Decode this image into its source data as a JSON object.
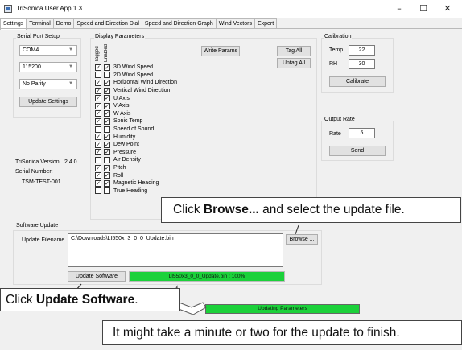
{
  "window": {
    "title": "TriSonica User App 1.3",
    "minimize": "–",
    "maximize": "☐",
    "close": "✕"
  },
  "tabs": [
    {
      "label": "Settings"
    },
    {
      "label": "Terminal"
    },
    {
      "label": "Demo"
    },
    {
      "label": "Speed and Direction Dial"
    },
    {
      "label": "Speed and Direction Graph"
    },
    {
      "label": "Wind Vectors"
    },
    {
      "label": "Expert"
    }
  ],
  "serial_port_setup": {
    "label": "Serial Port Setup",
    "port": "COM4",
    "baud": "115200",
    "parity": "No Parity",
    "update_button": "Update Settings"
  },
  "device_info": {
    "version_label": "TriSonica Version:",
    "version_value": "2.4.0",
    "serial_label": "Serial Number:",
    "serial_value": "TSM-TEST-001"
  },
  "display_parameters": {
    "label": "Display Parameters",
    "col_tagged": "Tagged",
    "col_enabled": "Enabled",
    "write_button": "Write Params",
    "tag_all_button": "Tag All",
    "untag_all_button": "Untag All",
    "params": [
      {
        "name": "3D Wind Speed",
        "tagged": true,
        "enabled": true
      },
      {
        "name": "2D Wind Speed",
        "tagged": false,
        "enabled": false
      },
      {
        "name": "Horizontal Wind Direction",
        "tagged": true,
        "enabled": true
      },
      {
        "name": "Vertical Wind Direction",
        "tagged": true,
        "enabled": true
      },
      {
        "name": "U Axis",
        "tagged": true,
        "enabled": true
      },
      {
        "name": "V Axis",
        "tagged": true,
        "enabled": true
      },
      {
        "name": "W Axis",
        "tagged": true,
        "enabled": true
      },
      {
        "name": "Sonic Temp",
        "tagged": true,
        "enabled": true
      },
      {
        "name": "Speed of Sound",
        "tagged": false,
        "enabled": false
      },
      {
        "name": "Humidity",
        "tagged": true,
        "enabled": true
      },
      {
        "name": "Dew Point",
        "tagged": true,
        "enabled": true
      },
      {
        "name": "Pressure",
        "tagged": true,
        "enabled": true
      },
      {
        "name": "Air Density",
        "tagged": false,
        "enabled": false
      },
      {
        "name": "Pitch",
        "tagged": true,
        "enabled": true
      },
      {
        "name": "Roll",
        "tagged": true,
        "enabled": true
      },
      {
        "name": "Magnetic Heading",
        "tagged": true,
        "enabled": true
      },
      {
        "name": "True Heading",
        "tagged": false,
        "enabled": false
      }
    ]
  },
  "calibration": {
    "label": "Calibration",
    "temp_label": "Temp",
    "temp_value": "22",
    "rh_label": "RH",
    "rh_value": "30",
    "calibrate_button": "Calibrate"
  },
  "output_rate": {
    "label": "Output Rate",
    "rate_label": "Rate",
    "rate_value": "5",
    "send_button": "Send"
  },
  "software_update": {
    "label": "Software Update",
    "filename_label": "Update Filename",
    "filename_value": "C:\\Downloads\\LI550x_3_0_0_Update.bin",
    "browse_button": "Browse ...",
    "update_button": "Update Software",
    "progress_text": "LI550x3_0_0_Update.bin : 100%",
    "progress_fraction": 1.0,
    "status_text": "Updating Parameters"
  },
  "callouts": {
    "browse_pre": "Click ",
    "browse_bold": "Browse...",
    "browse_post": " and select the update file.",
    "update_pre": "Click ",
    "update_bold": "Update Software",
    "update_post": ".",
    "wait": "It might take a minute or two for the update to finish."
  }
}
